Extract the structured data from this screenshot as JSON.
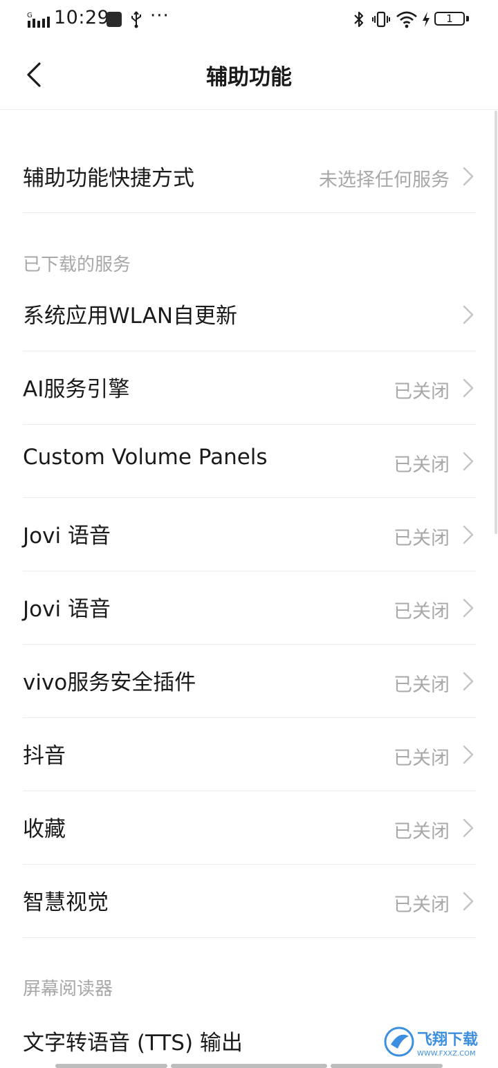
{
  "status_bar": {
    "signal_label": "G",
    "time": "10:29",
    "more": "···",
    "battery": "1"
  },
  "header": {
    "title": "辅助功能"
  },
  "shortcut": {
    "label": "辅助功能快捷方式",
    "value": "未选择任何服务"
  },
  "downloaded": {
    "header": "已下载的服务",
    "items": [
      {
        "label": "系统应用WLAN自更新",
        "value": ""
      },
      {
        "label": "AI服务引擎",
        "value": "已关闭"
      },
      {
        "label": "Custom Volume Panels",
        "value": "已关闭"
      },
      {
        "label": "Jovi 语音",
        "value": "已关闭"
      },
      {
        "label": "Jovi 语音",
        "value": "已关闭"
      },
      {
        "label": "vivo服务安全插件",
        "value": "已关闭"
      },
      {
        "label": "抖音",
        "value": "已关闭"
      },
      {
        "label": "收藏",
        "value": "已关闭"
      },
      {
        "label": "智慧视觉",
        "value": "已关闭"
      }
    ]
  },
  "screen_reader": {
    "header": "屏幕阅读器",
    "items": [
      {
        "label": "文字转语音 (TTS) 输出"
      }
    ]
  },
  "watermark": {
    "brand": "飞翔下载",
    "site": "WWW.FXXZ.COM",
    "color": "#3b8ee0"
  }
}
